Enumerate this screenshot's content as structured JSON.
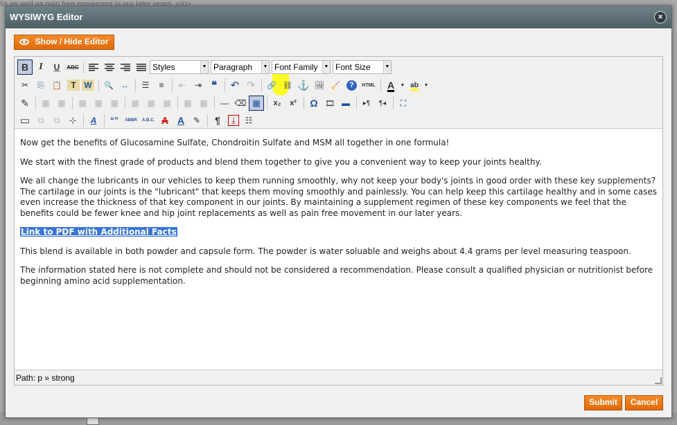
{
  "background": {
    "text": "tis as well as pain free movement in our later years. </p>"
  },
  "dialog": {
    "title": "WYSIWYG Editor",
    "close_glyph": "×"
  },
  "show_hide_label": "Show / Hide Editor",
  "toolbar": {
    "row1": {
      "bold": "B",
      "italic": "I",
      "underline": "U",
      "strike": "ABC",
      "styles": "Styles",
      "format": "Paragraph",
      "font_family": "Font Family",
      "font_size": "Font Size"
    },
    "row2": {
      "cut": "✂",
      "copy": "⎘",
      "paste": "📋",
      "paste_text": "T",
      "paste_word": "W",
      "find": "🔍",
      "replace": "↔",
      "bullist": "☰",
      "numlist": "≡",
      "outdent": "⇤",
      "indent": "⇥",
      "blockquote": "❝",
      "undo": "↶",
      "redo": "↷",
      "link": "🔗",
      "unlink": "⛓",
      "anchor": "⚓",
      "image": "🖼",
      "cleanup": "🧹",
      "help": "?",
      "html": "HTML",
      "forecolor": "A",
      "backcolor": "ab"
    },
    "row3": {
      "edit": "✎",
      "table": "▦",
      "hr": "—",
      "remove_format": "⌫",
      "visual_aid": "▦",
      "sub": "x₂",
      "sup": "x²",
      "charmap": "Ω",
      "media": "🎞",
      "hr2": "▬",
      "ltr": "▸¶",
      "rtl": "¶◂",
      "fullscreen": "⛶"
    },
    "row4": {
      "insert_layer": "▭",
      "forward": "⧉",
      "backward": "⧉",
      "absolute": "⊹",
      "styleprops": "A",
      "cite": "“”",
      "abbr": "ABBR",
      "acronym": "A.B.C.",
      "del": "A",
      "ins": "A",
      "attribs": "✎",
      "nonbreaking": "¶",
      "pagebreak": "⤓",
      "template": "☷"
    }
  },
  "content": {
    "p1": "Now get the benefits of Glucosamine Sulfate, Chondroitin Sulfate and MSM all together in one formula!",
    "p2": "We start with the finest grade of products and blend them together to give you a convenient way to keep your joints healthy.",
    "p3": "We all change the lubricants in our vehicles to keep them running smoothly, why not keep your body's joints in good order with these key supplements? The cartilage in our joints is the \"lubricant\" that keeps them moving smoothly and painlessly. You can help keep this cartilage healthy and in some cases even increase the thickness of that key component in our joints. By maintaining a supplement regimen of these key components we feel that the benefits could be fewer knee and hip joint replacements as well as pain free movement in our later years.",
    "link": "Link to PDF with Additional Facts",
    "p4": "This blend is available in both powder and capsule form. The powder is water soluable and weighs about 4.4 grams per level measuring teaspoon.",
    "p5": "The information stated here is not complete and should not be considered a recommendation. Please consult a qualified physician or nutritionist before beginning amino acid supplementation."
  },
  "status": {
    "path": "Path: p » strong"
  },
  "buttons": {
    "submit": "Submit",
    "cancel": "Cancel"
  },
  "colors": {
    "accent": "#f07a17",
    "titlebar": "#5a6c72",
    "selection": "#3875d7",
    "highlighter": "#ffff00"
  }
}
